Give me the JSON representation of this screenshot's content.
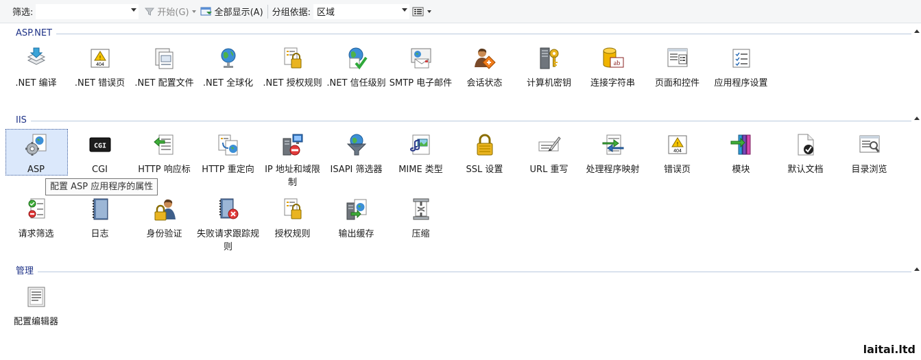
{
  "toolbar": {
    "filter_label": "筛选:",
    "filter_value": "",
    "start_label": "开始(G)",
    "show_all_label": "全部显示(A)",
    "group_by_label": "分组依据:",
    "group_by_value": "区域"
  },
  "groups": {
    "aspnet": {
      "title": "ASP.NET",
      "items": [
        {
          "label": ".NET 编译",
          "icon": "stack-arrow-icon"
        },
        {
          "label": ".NET 错误页",
          "icon": "warning-404-icon"
        },
        {
          "label": ".NET 配置文件",
          "icon": "profile-window-icon"
        },
        {
          "label": ".NET 全球化",
          "icon": "globe-icon"
        },
        {
          "label": ".NET 授权规则",
          "icon": "lock-document-icon"
        },
        {
          "label": ".NET 信任级别",
          "icon": "globe-check-icon"
        },
        {
          "label": "SMTP 电子邮件",
          "icon": "email-icon"
        },
        {
          "label": "会话状态",
          "icon": "user-session-icon"
        },
        {
          "label": "计算机密钥",
          "icon": "server-key-icon"
        },
        {
          "label": "连接字符串",
          "icon": "database-string-icon"
        },
        {
          "label": "页面和控件",
          "icon": "page-controls-icon"
        },
        {
          "label": "应用程序设置",
          "icon": "app-settings-icon"
        }
      ]
    },
    "iis": {
      "title": "IIS",
      "items": [
        {
          "label": "ASP",
          "icon": "asp-gear-icon"
        },
        {
          "label": "CGI",
          "icon": "cgi-icon"
        },
        {
          "label": "HTTP 响应标",
          "icon": "http-response-icon"
        },
        {
          "label": "HTTP 重定向",
          "icon": "http-redirect-icon"
        },
        {
          "label": "IP 地址和域限制",
          "icon": "ip-restrict-icon"
        },
        {
          "label": "ISAPI 筛选器",
          "icon": "isapi-filter-icon"
        },
        {
          "label": "MIME 类型",
          "icon": "mime-icon"
        },
        {
          "label": "SSL 设置",
          "icon": "ssl-lock-icon"
        },
        {
          "label": "URL 重写",
          "icon": "url-rewrite-icon"
        },
        {
          "label": "处理程序映射",
          "icon": "handler-mapping-icon"
        },
        {
          "label": "错误页",
          "icon": "error-page-icon"
        },
        {
          "label": "模块",
          "icon": "modules-icon"
        },
        {
          "label": "默认文档",
          "icon": "default-document-icon"
        },
        {
          "label": "目录浏览",
          "icon": "directory-browse-icon"
        },
        {
          "label": "请求筛选",
          "icon": "request-filter-icon"
        },
        {
          "label": "日志",
          "icon": "log-icon"
        },
        {
          "label": "身份验证",
          "icon": "authentication-icon"
        },
        {
          "label": "失败请求跟踪规则",
          "icon": "failed-request-icon"
        },
        {
          "label": "授权规则",
          "icon": "authorization-icon"
        },
        {
          "label": "输出缓存",
          "icon": "output-cache-icon"
        },
        {
          "label": "压缩",
          "icon": "compression-icon"
        }
      ]
    },
    "mgmt": {
      "title": "管理",
      "items": [
        {
          "label": "配置编辑器",
          "icon": "config-editor-icon"
        }
      ]
    }
  },
  "tooltip": "配置 ASP 应用程序的属性",
  "watermark": "laitai.ltd"
}
